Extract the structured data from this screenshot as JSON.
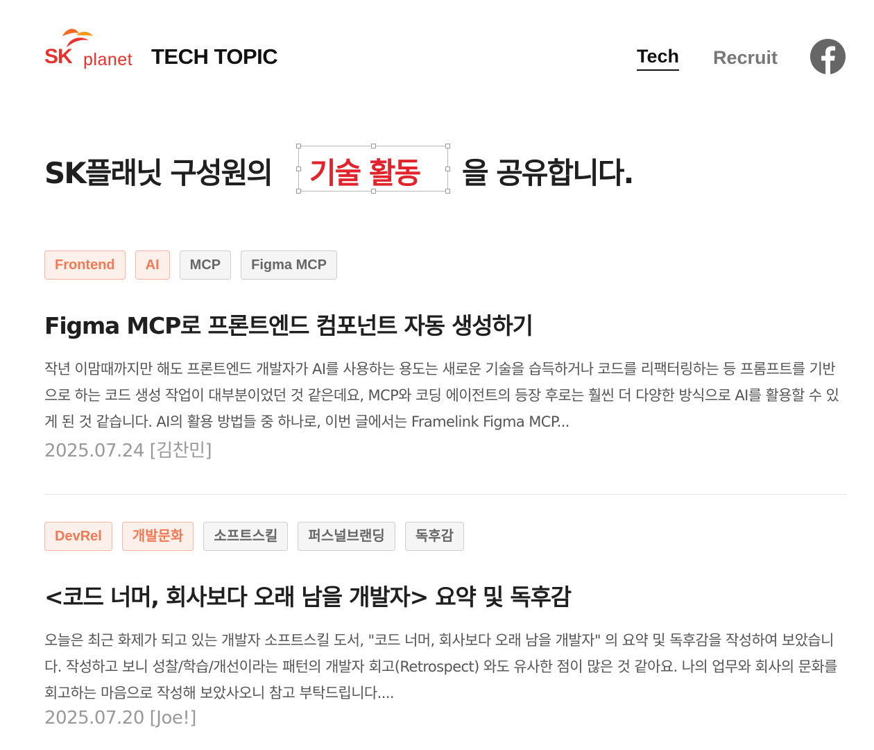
{
  "header": {
    "logo_sk": "SK",
    "logo_planet": "planet",
    "brand_title": "TECH TOPIC",
    "nav": {
      "tech": "Tech",
      "recruit": "Recruit"
    },
    "social_icon": "facebook-icon"
  },
  "hero": {
    "prefix": "SK플래닛 구성원의",
    "highlight": "기술 활동",
    "suffix": "을 공유합니다."
  },
  "articles": [
    {
      "tags": [
        {
          "label": "Frontend",
          "style": "accent"
        },
        {
          "label": "AI",
          "style": "accent"
        },
        {
          "label": "MCP",
          "style": "plain"
        },
        {
          "label": "Figma MCP",
          "style": "plain"
        }
      ],
      "title": "Figma MCP로 프론트엔드 컴포넌트 자동 생성하기",
      "summary": "작년 이맘때까지만 해도 프론트엔드 개발자가 AI를 사용하는 용도는 새로운 기술을 습득하거나 코드를 리팩터링하는 등 프롬프트를 기반으로 하는 코드 생성 작업이 대부분이었던 것 같은데요, MCP와 코딩 에이전트의 등장 후로는 훨씬 더 다양한 방식으로 AI를 활용할 수 있게 된 것 같습니다. AI의 활용 방법들 중 하나로, 이번 글에서는 Framelink Figma MCP...",
      "meta": "2025.07.24 [김찬민]"
    },
    {
      "tags": [
        {
          "label": "DevRel",
          "style": "accent"
        },
        {
          "label": "개발문화",
          "style": "accent"
        },
        {
          "label": "소프트스킬",
          "style": "plain"
        },
        {
          "label": "퍼스널브랜딩",
          "style": "plain"
        },
        {
          "label": "독후감",
          "style": "plain"
        }
      ],
      "title": "<코드 너머, 회사보다 오래 남을 개발자> 요약 및 독후감",
      "summary": "오늘은 최근 화제가 되고 있는 개발자 소프트스킬 도서, \"코드 너머, 회사보다 오래 남을 개발자\" 의 요약 및 독후감을 작성하여 보았습니다. 작성하고 보니 성찰/학습/개선이라는 패턴의 개발자 회고(Retrospect) 와도 유사한 점이 많은 것 같아요. 나의 업무와 회사의 문화를 회고하는 마음으로 작성해 보았사오니 참고 부탁드립니다....",
      "meta": "2025.07.20 [Joe!]"
    }
  ],
  "colors": {
    "brand_red": "#e8312a",
    "highlight_red": "#e3232b",
    "tag_accent_text": "#f07a55",
    "tag_accent_bg": "#fdf0eb",
    "tag_plain_bg": "#f5f5f5"
  }
}
